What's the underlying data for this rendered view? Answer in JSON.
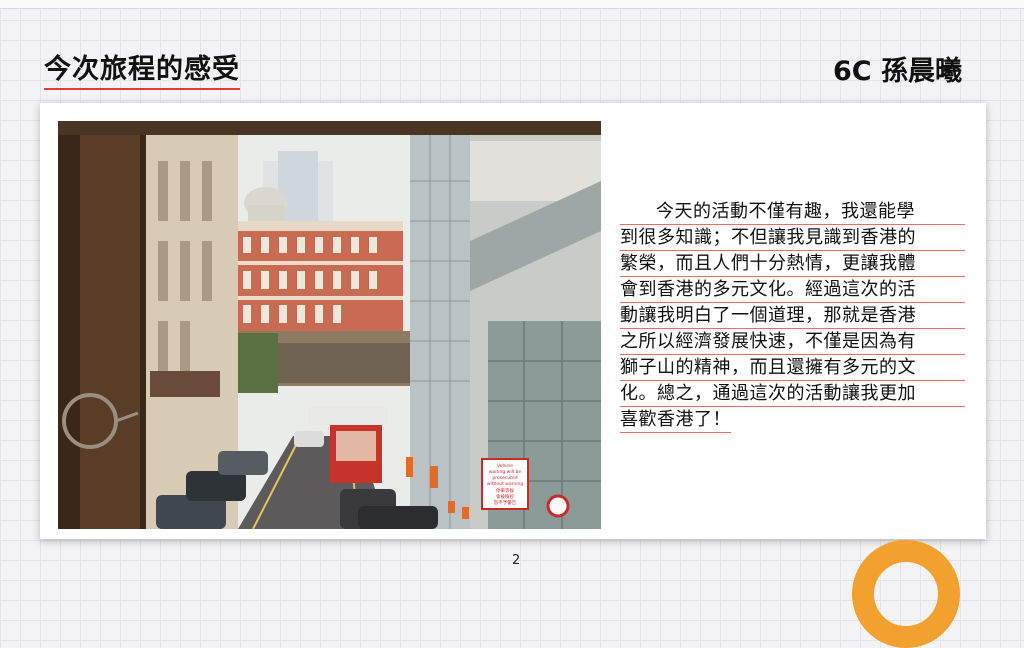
{
  "slide": {
    "title": "今次旅程的感受",
    "author": "6C  孫晨曦",
    "page_number": "2"
  },
  "body": {
    "lines": [
      "今天的活動不僅有趣，我還能學",
      "到很多知識；不但讓我見識到香港的",
      "繁榮，而且人們十分熱情，更讓我體",
      "會到香港的多元文化。經過這次的活",
      "動讓我明白了一個道理，那就是香港",
      "之所以經濟發展快速，不僅是因為有",
      "獅子山的精神，而且還擁有多元的文",
      "化。總之，通過這次的活動讓我更加",
      "喜歡香港了！"
    ]
  },
  "photo": {
    "description_icon": "street-photo",
    "sign_text": [
      "Vehicle",
      "waiting will be",
      "prosecuted",
      "without warning",
      "停車等候",
      "會被檢控",
      "恕不予警告"
    ]
  },
  "colors": {
    "underline": "#f06a6a",
    "accent_orange": "#f2a12e"
  }
}
